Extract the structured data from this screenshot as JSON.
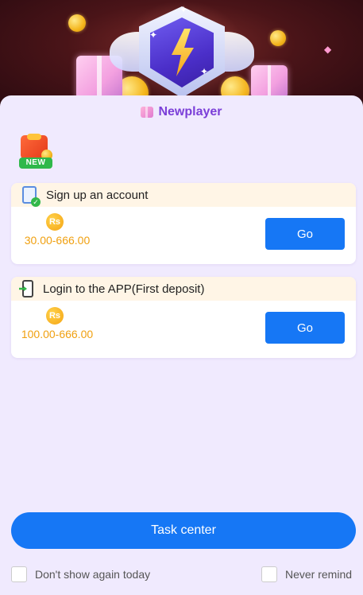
{
  "header": {
    "title": "Newplayer",
    "new_badge": "NEW"
  },
  "tasks": [
    {
      "icon": "task-check-icon",
      "title": "Sign up an account",
      "currency": "Rs",
      "reward": "30.00-666.00",
      "button": "Go"
    },
    {
      "icon": "phone-login-icon",
      "title": "Login to the APP(First deposit)",
      "currency": "Rs",
      "reward": "100.00-666.00",
      "button": "Go"
    }
  ],
  "footer": {
    "task_center_label": "Task center",
    "dont_show_label": "Don't show again today",
    "never_remind_label": "Never remind"
  },
  "colors": {
    "accent": "#1677f5",
    "title": "#7b3fd8",
    "reward": "#f0a010",
    "sheet": "#f0eafe",
    "card_head": "#fff5e6"
  }
}
